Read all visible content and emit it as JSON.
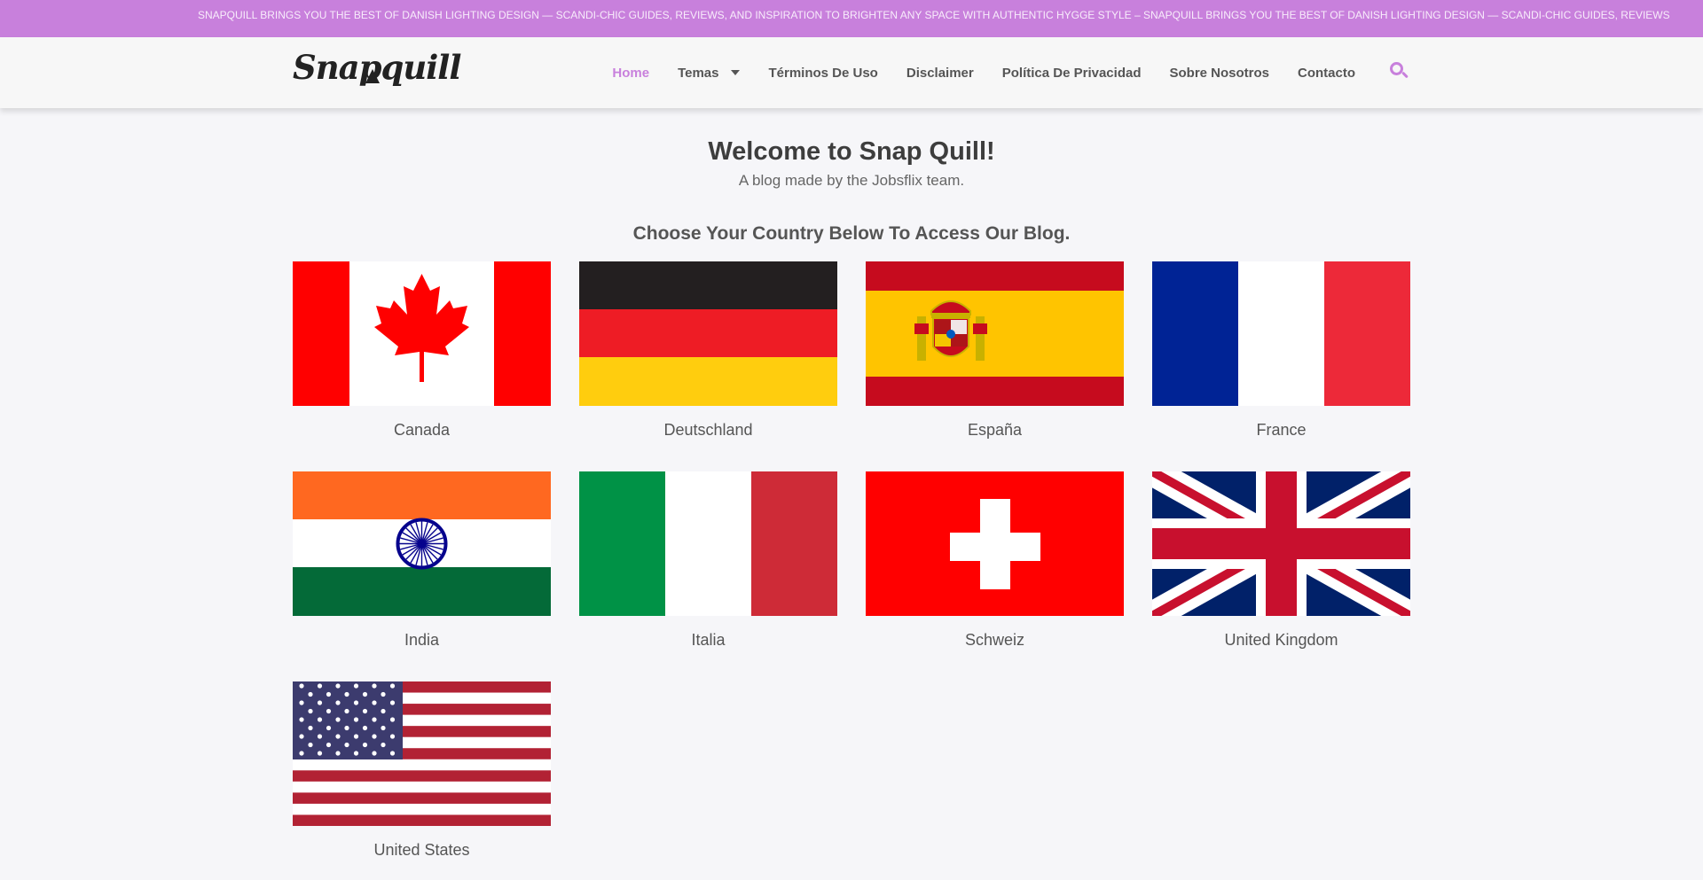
{
  "ticker": {
    "text": "SNAPQUILL BRINGS YOU THE BEST OF DANISH LIGHTING DESIGN — SCANDI-CHIC GUIDES, REVIEWS, AND INSPIRATION TO BRIGHTEN ANY SPACE WITH AUTHENTIC HYGGE STYLE – SNAPQUILL BRINGS YOU THE BEST OF DANISH LIGHTING DESIGN — SCANDI-CHIC GUIDES, REVIEWS"
  },
  "header": {
    "logo": "Snapquill",
    "nav": [
      {
        "label": "Home"
      },
      {
        "label": "Temas"
      },
      {
        "label": "Términos De Uso"
      },
      {
        "label": "Disclaimer"
      },
      {
        "label": "Política De Privacidad"
      },
      {
        "label": "Sobre Nosotros"
      },
      {
        "label": "Contacto"
      }
    ],
    "search_icon": "search-icon"
  },
  "hero": {
    "title": "Welcome to Snap Quill!",
    "subtitle": "A blog made by the Jobsflix team.",
    "prompt": "Choose Your Country Below To Access Our Blog."
  },
  "countries": [
    {
      "name": "Canada"
    },
    {
      "name": "Deutschland"
    },
    {
      "name": "España"
    },
    {
      "name": "France"
    },
    {
      "name": "India"
    },
    {
      "name": "Italia"
    },
    {
      "name": "Schweiz"
    },
    {
      "name": "United Kingdom"
    },
    {
      "name": "United States"
    }
  ],
  "colors": {
    "accent": "#c880dc",
    "text": "#555555",
    "background": "#f6f6f9"
  }
}
